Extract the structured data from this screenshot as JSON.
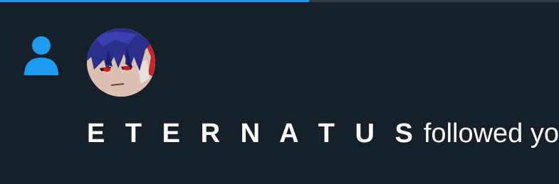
{
  "progress": {
    "fraction": 0.553,
    "fill_color": "#1d9bf0",
    "track_color": "#2f3b47"
  },
  "notification": {
    "type_icon": "person-icon",
    "icon_color": "#1d9bf0",
    "display_name": "E T E R N A T U S",
    "action_text": "followed you"
  },
  "theme": {
    "background": "#15202b",
    "text": "#ffffff"
  }
}
